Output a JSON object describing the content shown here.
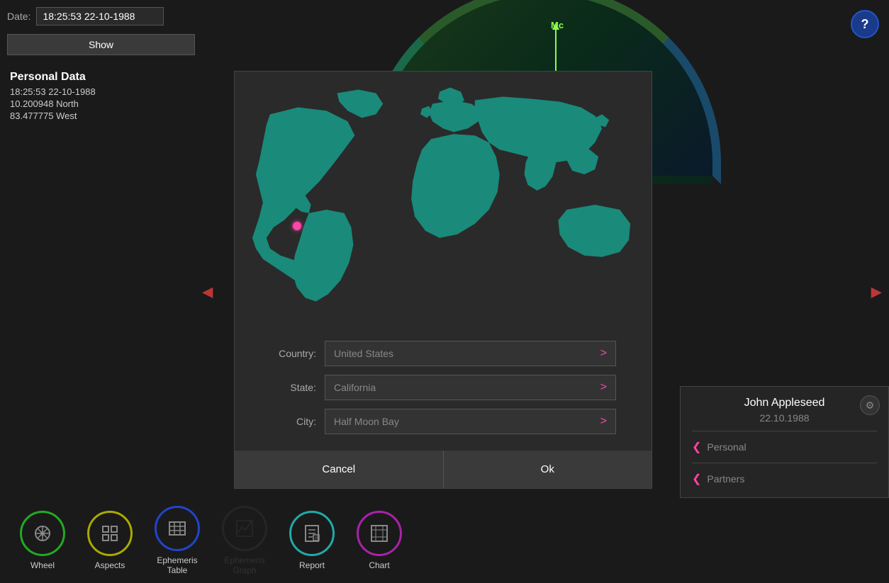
{
  "topbar": {
    "date_label": "Date:",
    "date_value": "18:25:53 22-10-1988",
    "show_label": "Show"
  },
  "personal_data": {
    "title": "Personal Data",
    "line1": "18:25:53 22-10-1988",
    "line2": "10.200948 North",
    "line3": "83.477775 West"
  },
  "help": {
    "label": "?"
  },
  "wheel_labels": {
    "mc": "Mc"
  },
  "modal": {
    "country_label": "Country:",
    "country_value": "United States",
    "state_label": "State:",
    "state_value": "California",
    "city_label": "City:",
    "city_value": "Half Moon Bay",
    "cancel_label": "Cancel",
    "ok_label": "Ok"
  },
  "nav": {
    "items": [
      {
        "id": "wheel",
        "label": "Wheel",
        "icon": "⊙"
      },
      {
        "id": "aspects",
        "label": "Aspects",
        "icon": "⊞"
      },
      {
        "id": "ephemeris-table",
        "label": "Ephemeris\nTable",
        "icon": "⊟"
      },
      {
        "id": "ephemeris-graph",
        "label": "Ephemeris\nGraph",
        "icon": "↗"
      },
      {
        "id": "report",
        "label": "Report",
        "icon": "⊡"
      },
      {
        "id": "chart",
        "label": "Chart",
        "icon": "⬚"
      }
    ]
  },
  "profile": {
    "name": "John Appleseed",
    "date": "22.10.1988",
    "personal_label": "Personal",
    "partners_label": "Partners",
    "gear_icon": "⚙"
  }
}
